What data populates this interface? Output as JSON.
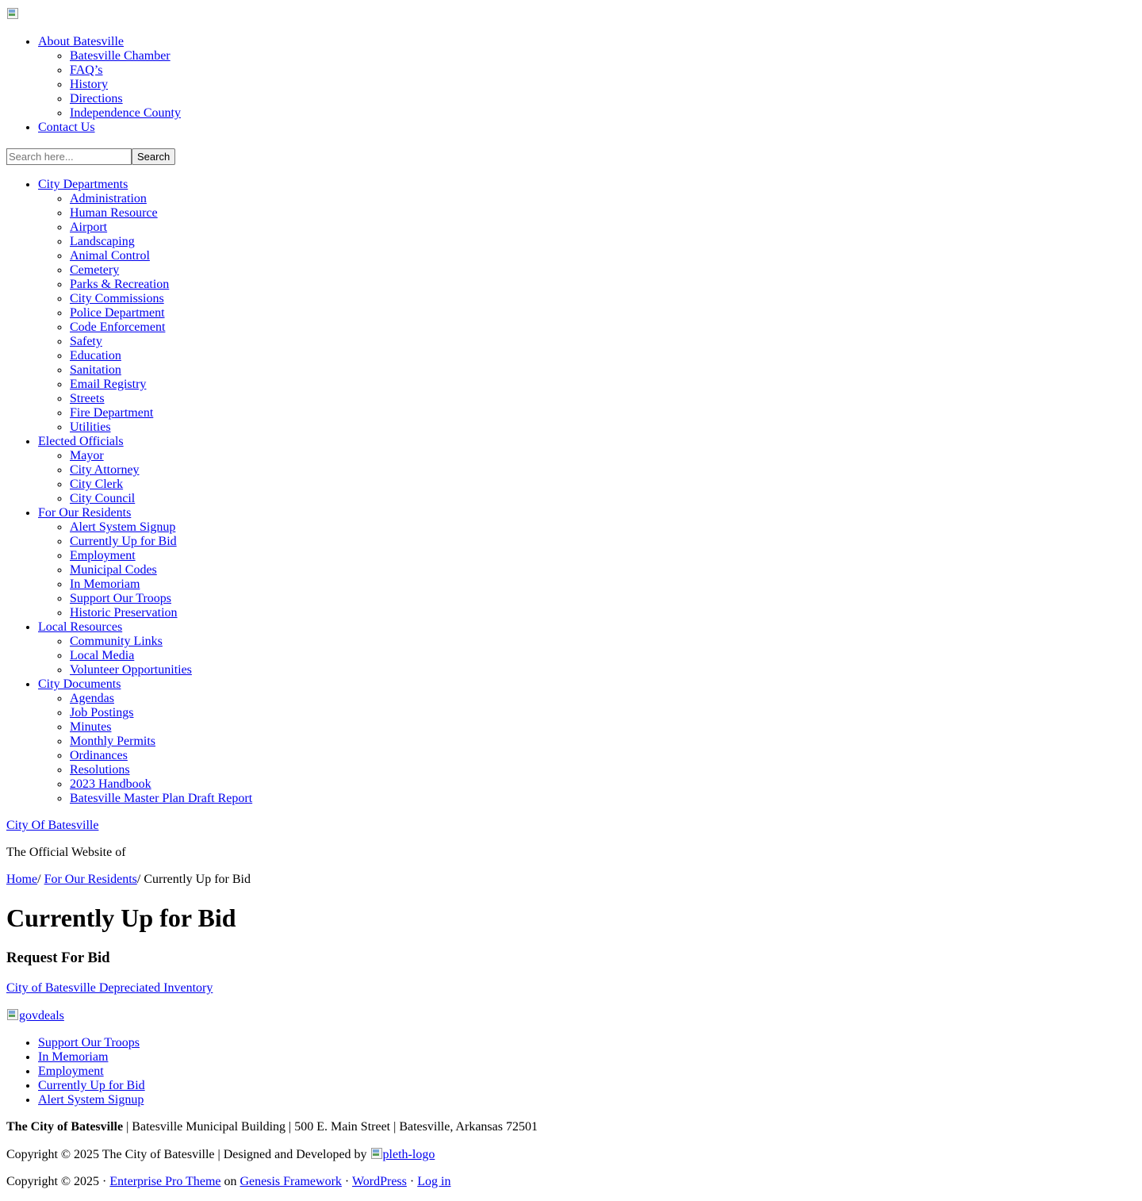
{
  "header": {
    "logo_icon": "broken-image-icon"
  },
  "top_nav": [
    {
      "label": "About Batesville",
      "children": [
        "Batesville Chamber",
        "FAQ’s",
        "History",
        "Directions",
        "Independence County"
      ]
    },
    {
      "label": "Contact Us",
      "children": []
    }
  ],
  "search": {
    "placeholder": "Search here...",
    "button_label": "Search"
  },
  "main_nav": [
    {
      "label": "City Departments",
      "children": [
        "Administration",
        "Human Resource",
        "Airport",
        "Landscaping",
        "Animal Control",
        "Cemetery",
        "Parks & Recreation",
        "City Commissions",
        "Police Department",
        "Code Enforcement",
        "Safety",
        "Education",
        "Sanitation",
        "Email Registry",
        "Streets",
        "Fire Department",
        "Utilities"
      ]
    },
    {
      "label": "Elected Officials",
      "children": [
        "Mayor",
        "City Attorney",
        "City Clerk",
        "City Council"
      ]
    },
    {
      "label": "For Our Residents",
      "children": [
        "Alert System Signup",
        "Currently Up for Bid",
        "Employment",
        "Municipal Codes",
        "In Memoriam",
        "Support Our Troops",
        "Historic Preservation"
      ]
    },
    {
      "label": "Local Resources",
      "children": [
        "Community Links",
        "Local Media",
        "Volunteer Opportunities"
      ]
    },
    {
      "label": "City Documents",
      "children": [
        "Agendas",
        "Job Postings",
        "Minutes",
        "Monthly Permits",
        "Ordinances",
        "Resolutions",
        "2023 Handbook",
        "Batesville Master Plan Draft Report"
      ]
    }
  ],
  "site": {
    "title": "City Of Batesville",
    "description": "The Official Website of"
  },
  "breadcrumb": {
    "home": "Home",
    "sep1": "/ ",
    "parent": "For Our Residents",
    "sep2": "/ ",
    "current": "Currently Up for Bid"
  },
  "content": {
    "page_title": "Currently Up for Bid",
    "section_heading": "Request For Bid",
    "inventory_link": "City of Batesville Depreciated Inventory",
    "govdeals_alt": "govdeals"
  },
  "sidebar_links": [
    "Support Our Troops",
    "In Memoriam",
    "Employment",
    "Currently Up for Bid",
    "Alert System Signup"
  ],
  "footer": {
    "org_name": "The City of Batesville",
    "address": " | Batesville Municipal Building | 500 E. Main Street | Batesville, Arkansas 72501",
    "copyright_line": "Copyright © 2025 The City of Batesville | Designed and Developed by ",
    "pleth_alt": "pleth-logo",
    "copyright2": "Copyright © 2025 · ",
    "theme_link": "Enterprise Pro Theme",
    "on_text": " on ",
    "framework_link": "Genesis Framework",
    "dot1": " · ",
    "wordpress_link": "WordPress",
    "dot2": " · ",
    "login_link": "Log in"
  }
}
